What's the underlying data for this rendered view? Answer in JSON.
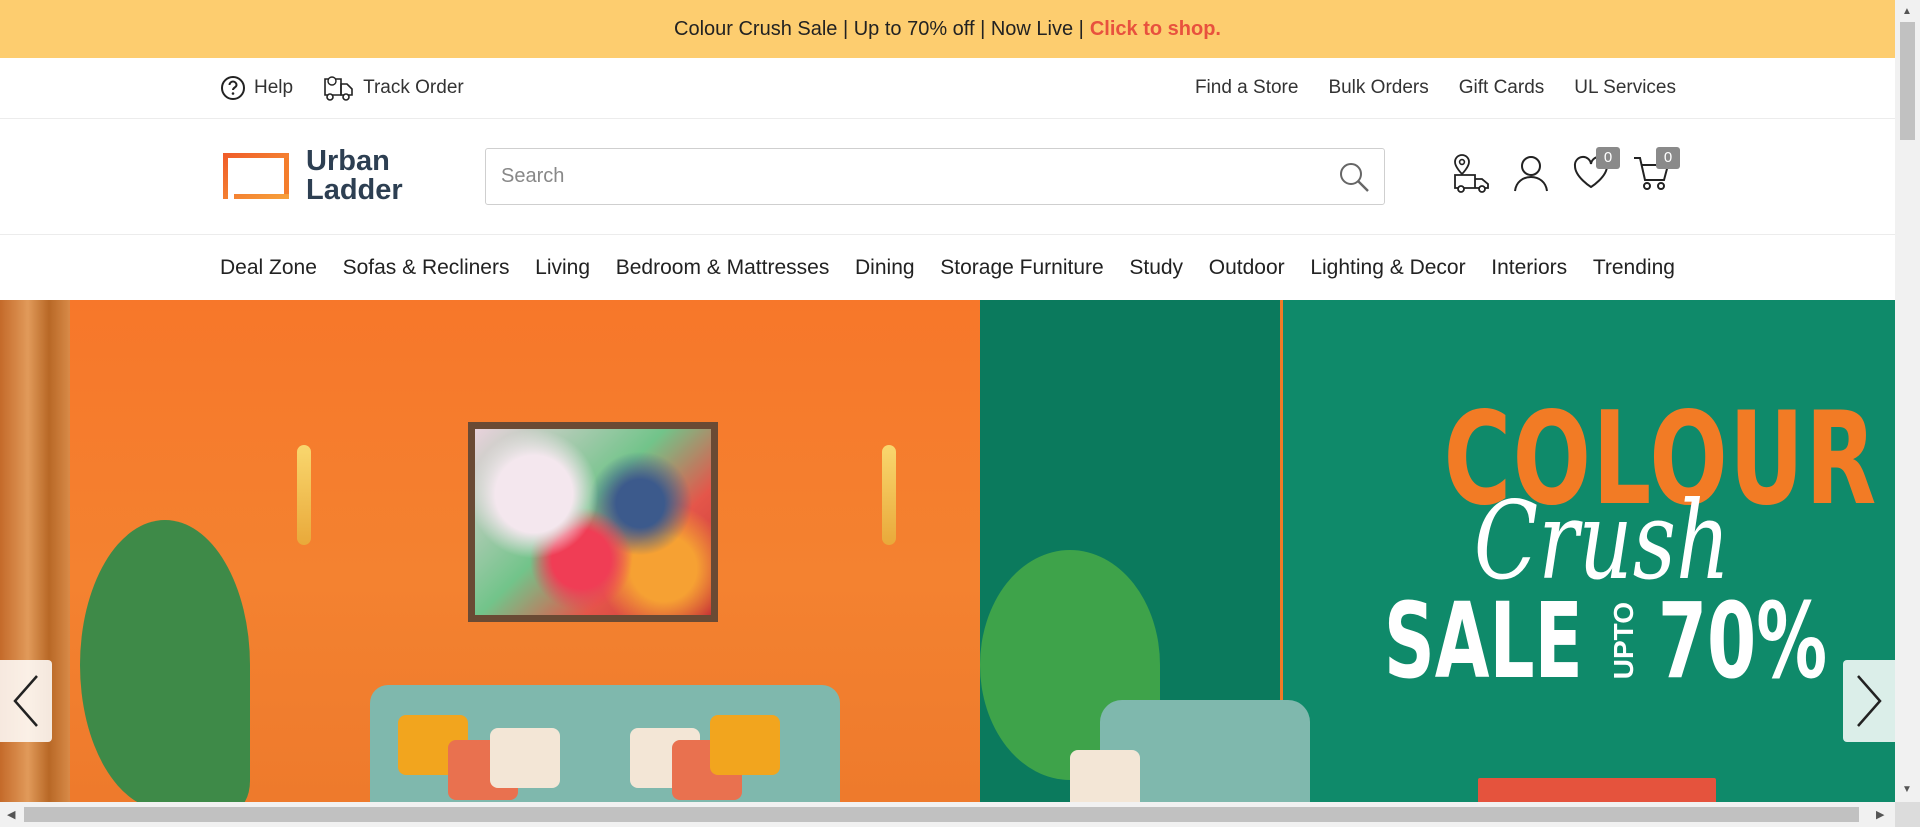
{
  "announcement": {
    "text": "Colour Crush Sale | Up to 70% off | Now Live | ",
    "cta": "Click to shop."
  },
  "utility": {
    "left": [
      {
        "label": "Help",
        "icon": "help-icon"
      },
      {
        "label": "Track Order",
        "icon": "truck-icon"
      }
    ],
    "right": [
      "Find a Store",
      "Bulk Orders",
      "Gift Cards",
      "UL Services"
    ]
  },
  "header": {
    "logo_line1": "Urban",
    "logo_line2": "Ladder",
    "search_placeholder": "Search",
    "wishlist_count": "0",
    "cart_count": "0"
  },
  "nav": {
    "items": [
      "Deal Zone",
      "Sofas & Recliners",
      "Living",
      "Bedroom & Mattresses",
      "Dining",
      "Storage Furniture",
      "Study",
      "Outdoor",
      "Lighting & Decor",
      "Interiors",
      "Trending"
    ]
  },
  "hero": {
    "line1": "COLOUR",
    "line2": "Crush",
    "sale": "SALE",
    "upto": "UPTO",
    "percent": "70%"
  },
  "colors": {
    "announcement_bg": "#fdcd6f",
    "cta": "#e8513e",
    "brand_orange": "#f27b25",
    "brand_navy": "#2d3f52",
    "hero_green": "#0f8a6a"
  }
}
